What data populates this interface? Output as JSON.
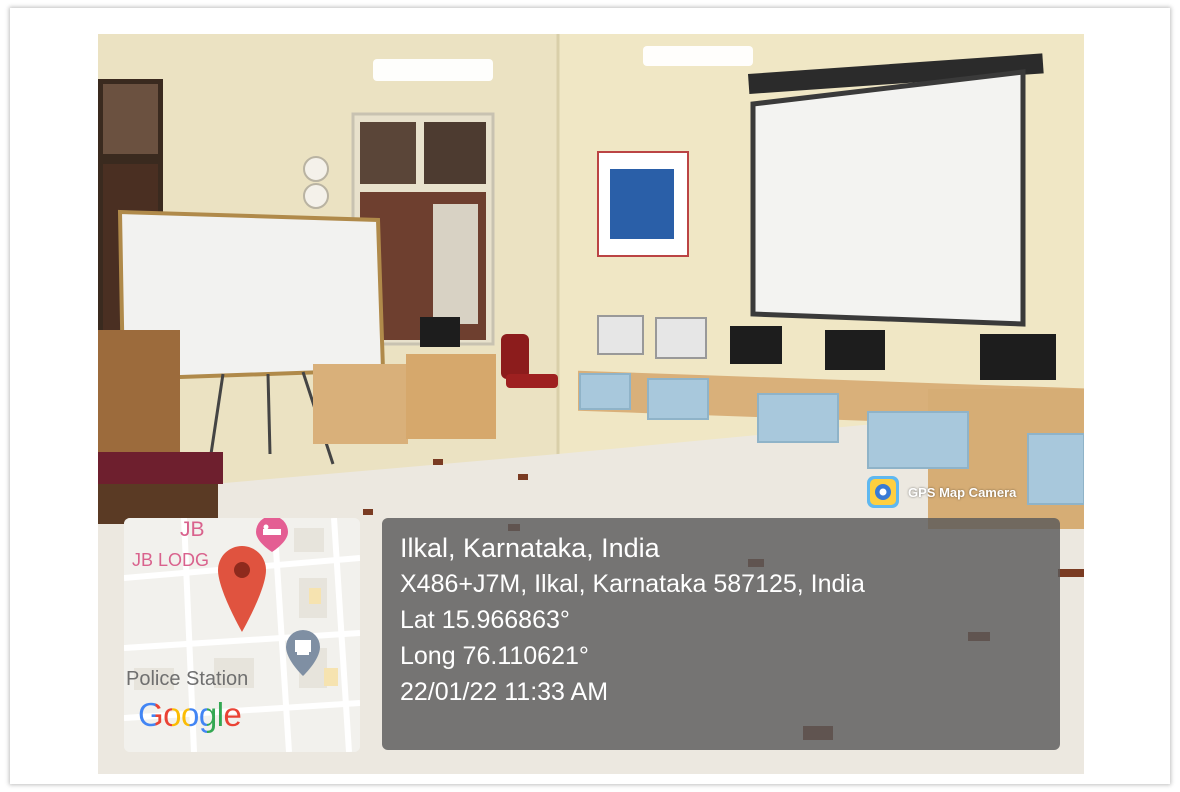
{
  "badge": {
    "label": "GPS Map Camera",
    "icon": "gps-map-camera-icon"
  },
  "map": {
    "place_top": "JB",
    "place_lodge": "JB LODG",
    "poi": "Police Station",
    "logo": "Google",
    "pin_color": "#e0533f",
    "icons": [
      "hotel-icon",
      "location-pin-icon",
      "police-icon"
    ]
  },
  "info": {
    "location": "Ilkal, Karnataka, India",
    "address": "X486+J7M, Ilkal, Karnataka 587125, India",
    "lat": "Lat 15.966863°",
    "long": "Long 76.110621°",
    "datetime": "22/01/22 11:33 AM"
  }
}
